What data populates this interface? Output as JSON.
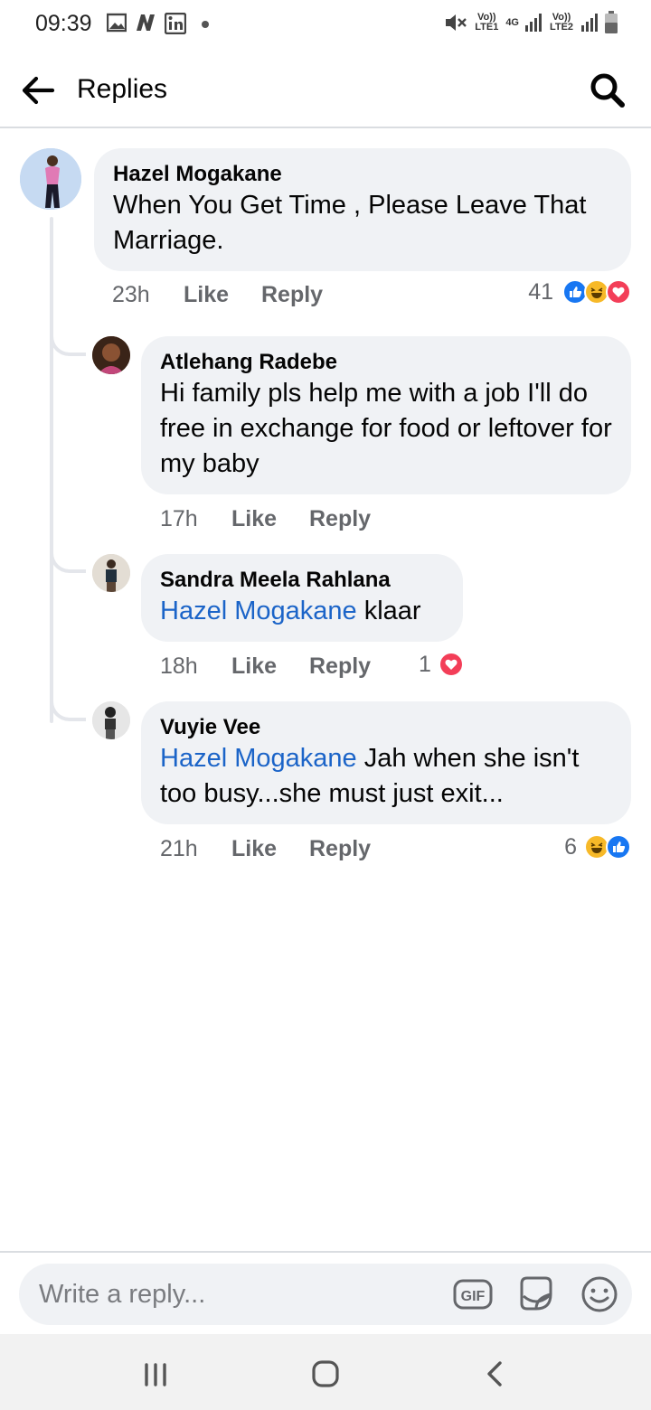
{
  "status_bar": {
    "time": "09:39",
    "left_icons": [
      "image-icon",
      "n-icon",
      "linkedin-icon",
      "dot-icon"
    ],
    "right_text": [
      "Vo)) LTE1",
      "4G",
      "Vo)) LTE2"
    ],
    "icons": [
      "mute-icon",
      "signal-icon",
      "signal-icon",
      "battery-icon"
    ]
  },
  "header": {
    "title": "Replies",
    "back_icon": "arrow-left-icon",
    "search_icon": "search-icon"
  },
  "comments": [
    {
      "author": "Hazel Mogakane",
      "mention": "",
      "text": "When You Get Time , Please Leave That Marriage.",
      "time": "23h",
      "like_label": "Like",
      "reply_label": "Reply",
      "reaction_count": "41",
      "reactions": [
        "like",
        "haha",
        "love"
      ]
    },
    {
      "author": "Atlehang Radebe",
      "mention": "",
      "text": "Hi family pls help me with a job I'll do free in exchange for food or leftover for my baby",
      "time": "17h",
      "like_label": "Like",
      "reply_label": "Reply",
      "reaction_count": "",
      "reactions": []
    },
    {
      "author": "Sandra Meela Rahlana",
      "mention": "Hazel Mogakane",
      "text": "klaar",
      "time": "18h",
      "like_label": "Like",
      "reply_label": "Reply",
      "reaction_count": "1",
      "reactions": [
        "love"
      ]
    },
    {
      "author": "Vuyie Vee",
      "mention": "Hazel Mogakane",
      "text": "Jah when she isn't too busy...she must just exit...",
      "time": "21h",
      "like_label": "Like",
      "reply_label": "Reply",
      "reaction_count": "6",
      "reactions": [
        "haha",
        "like"
      ]
    }
  ],
  "composer": {
    "placeholder": "Write a reply...",
    "gif_label": "GIF",
    "icons": [
      "gif-icon",
      "sticker-icon",
      "emoji-icon"
    ]
  },
  "nav_bar": {
    "icons": [
      "recent-apps-icon",
      "home-icon",
      "back-icon"
    ]
  },
  "colors": {
    "bubble": "#f0f2f5",
    "mention": "#1b64c8",
    "like_blue": "#1877f2",
    "love_red": "#f33e58",
    "haha_yellow": "#f7b928",
    "meta_grey": "#65676b"
  }
}
